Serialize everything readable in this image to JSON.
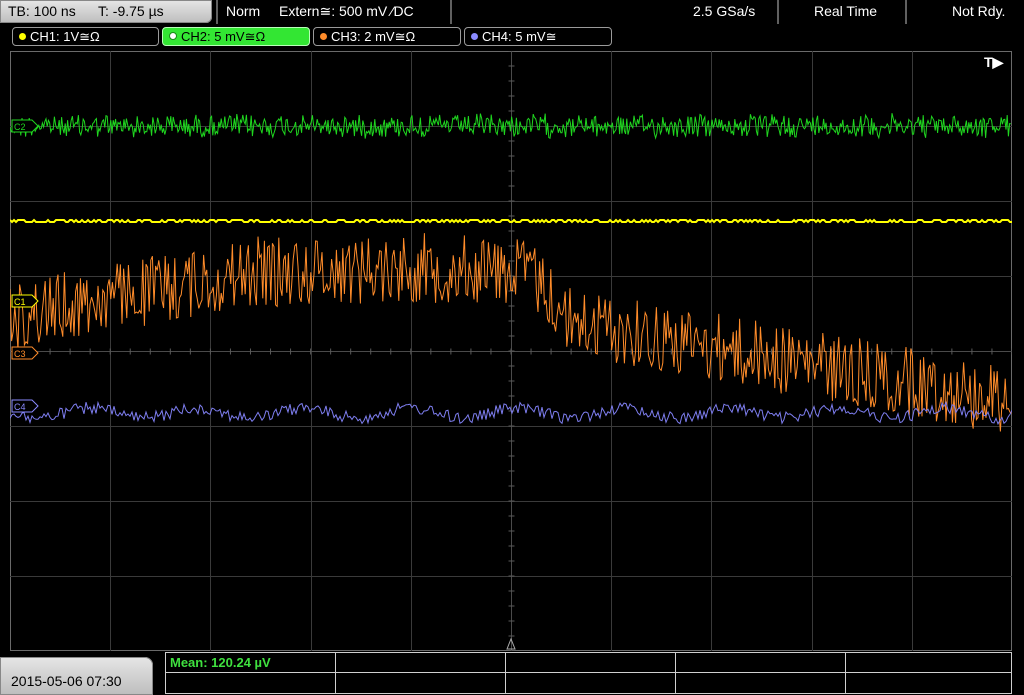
{
  "topbar": {
    "timebase": "TB: 100 ns",
    "trigger_time": "T: -9.75 µs",
    "mode": "Norm",
    "trigger_source": "Extern≅: 500 mV ⁄DC",
    "sample_rate": "2.5 GSa/s",
    "acq_mode": "Real Time",
    "status": "Not Rdy."
  },
  "channels": [
    {
      "label": "CH1: 1V≅Ω",
      "color": "#ffff00",
      "active": false
    },
    {
      "label": "CH2: 5 mV≅Ω",
      "color": "#33e633",
      "active": true
    },
    {
      "label": "CH3: 2 mV≅Ω",
      "color": "#ff8c2a",
      "active": false
    },
    {
      "label": "CH4: 5 mV≅",
      "color": "#8a8aff",
      "active": false
    }
  ],
  "markers": {
    "c2": "C2",
    "c1": "C1",
    "c3": "C3",
    "c4": "C4",
    "trigger": "T▶"
  },
  "traces": {
    "ch2_color": "#1fd61f",
    "ch1_color": "#ffff00",
    "ch3_color": "#ff8c2a",
    "ch4_color": "#7e7ef0"
  },
  "footer": {
    "datetime": "2015-05-06 07:30",
    "measurement": "Mean: 120.24 µV"
  }
}
